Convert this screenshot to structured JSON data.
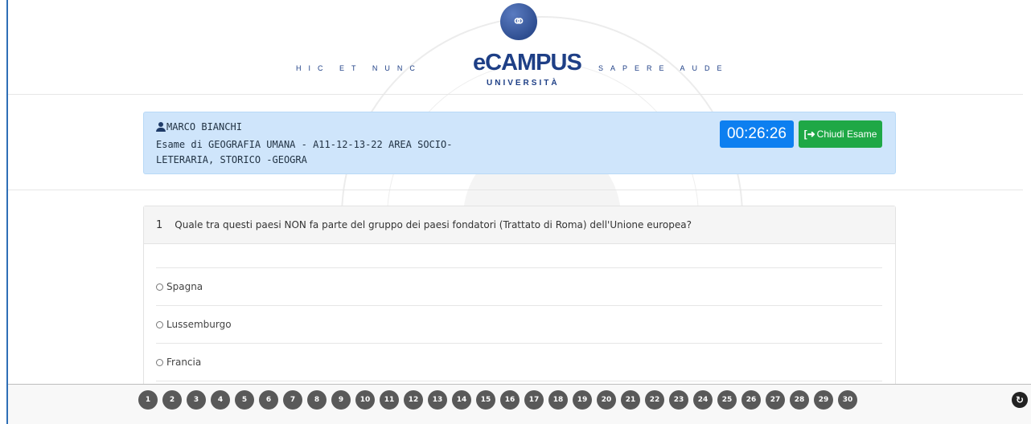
{
  "header": {
    "motto_left": "HIC ET NUNC",
    "brand": "eCAMPUS",
    "brand_sub": "UNIVERSITÀ",
    "motto_right": "SAPERE AUDE",
    "logo_icon": "link-logo-icon"
  },
  "exam_info": {
    "student_icon": "user-icon",
    "student_name": "MARCO BIANCHI",
    "exam_title": "Esame di GEOGRAFIA UMANA - A11-12-13-22 AREA SOCIO-LETERARIA, STORICO -GEOGRA",
    "timer": "00:26:26",
    "close_button": "Chiudi Esame",
    "close_icon": "sign-out-icon",
    "colors": {
      "box": "#cfe5fb",
      "timer": "#0d7ff0",
      "close": "#1fa846"
    }
  },
  "question": {
    "number": "1",
    "text": "Quale tra questi paesi NON fa parte del gruppo dei paesi fondatori (Trattato di Roma) dell'Unione europea?",
    "answers": [
      "Spagna",
      "Lussemburgo",
      "Francia"
    ]
  },
  "navigation": {
    "pages": [
      "1",
      "2",
      "3",
      "4",
      "5",
      "6",
      "7",
      "8",
      "9",
      "10",
      "11",
      "12",
      "13",
      "14",
      "15",
      "16",
      "17",
      "18",
      "19",
      "20",
      "21",
      "22",
      "23",
      "24",
      "25",
      "26",
      "27",
      "28",
      "29",
      "30"
    ],
    "refresh_icon": "refresh-icon"
  }
}
